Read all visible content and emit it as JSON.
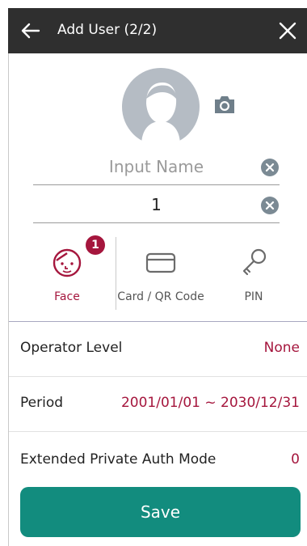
{
  "header": {
    "title": "Add User (2/2)",
    "back_icon": "arrow-left-icon",
    "close_icon": "close-icon"
  },
  "profile": {
    "avatar_icon": "user-avatar-icon",
    "camera_icon": "camera-icon"
  },
  "form": {
    "name_placeholder": "Input Name",
    "name_value": "",
    "id_value": "1"
  },
  "auth_methods": [
    {
      "label": "Face",
      "icon": "face-icon",
      "badge": "1",
      "color": "#a5163d"
    },
    {
      "label": "Card / QR Code",
      "icon": "card-icon"
    },
    {
      "label": "PIN",
      "icon": "key-icon"
    }
  ],
  "settings": [
    {
      "label": "Operator Level",
      "value": "None"
    },
    {
      "label": "Period",
      "value": "2001/01/01 ~ 2030/12/31"
    },
    {
      "label": "Extended Private Auth Mode",
      "value": "0"
    }
  ],
  "actions": {
    "save_label": "Save"
  },
  "colors": {
    "header_bg": "#2f2f2f",
    "accent": "#a5163d",
    "primary_button": "#128c7e"
  }
}
